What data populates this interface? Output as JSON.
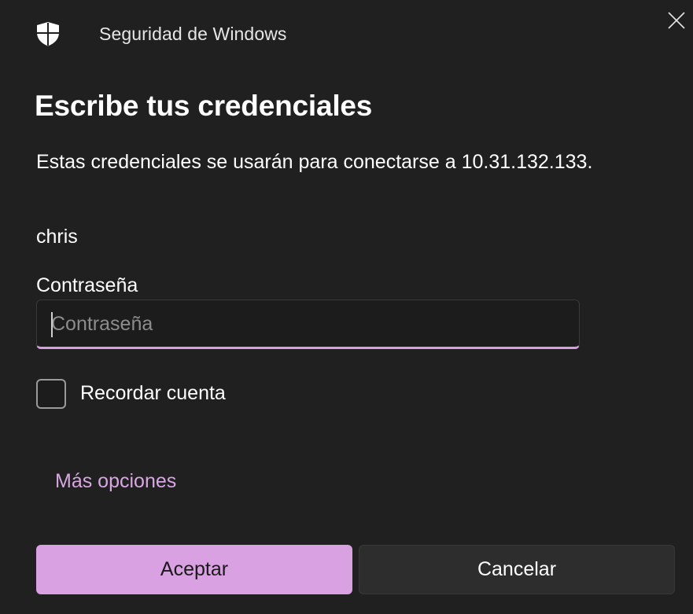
{
  "window": {
    "app_title": "Seguridad de Windows",
    "shield_icon": "shield-icon",
    "close_icon": "close-icon"
  },
  "dialog": {
    "heading": "Escribe tus credenciales",
    "description": "Estas credenciales se usarán para conectarse a 10.31.132.133.",
    "username": "chris",
    "password_label": "Contraseña",
    "password_value": "",
    "password_placeholder": "Contraseña",
    "remember_label": "Recordar cuenta",
    "remember_checked": false,
    "more_options": "Más opciones",
    "accept_label": "Aceptar",
    "cancel_label": "Cancelar"
  },
  "colors": {
    "background": "#202020",
    "accent": "#d9a0e2",
    "link": "#d8a7e3",
    "secondary_button": "#2d2d2d"
  }
}
